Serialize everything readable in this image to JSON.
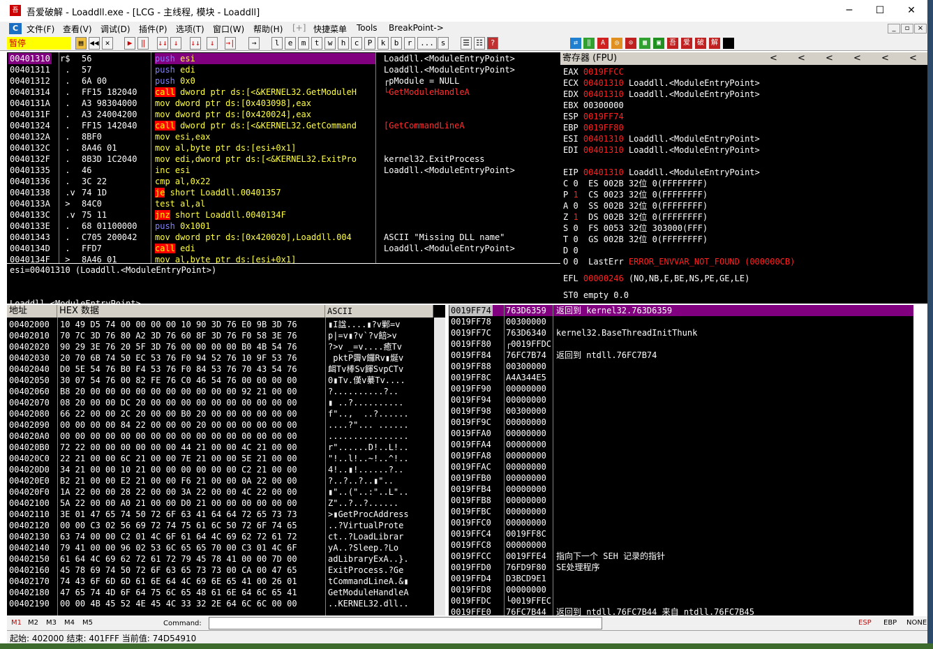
{
  "app": {
    "icon_text": "吾爱",
    "title": "吾爱破解 - Loaddll.exe - [LCG - 主线程, 模块 - Loaddll]"
  },
  "window_controls": {
    "minimize": "─",
    "maximize": "☐",
    "close": "✕"
  },
  "menu": {
    "icon_text": "C",
    "items": [
      "文件(F)",
      "查看(V)",
      "调试(D)",
      "插件(P)",
      "选项(T)",
      "窗口(W)",
      "帮助(H)",
      "[+]",
      "快捷菜单",
      "Tools",
      "BreakPoint->"
    ],
    "mdi": [
      "_",
      "▫",
      "×"
    ]
  },
  "toolbar": {
    "status": "暂停",
    "buttons": [
      "▶",
      "◀◀",
      "✕",
      "▶",
      "‖",
      "↓↓",
      "↓",
      "↓↓",
      "↓",
      "→|",
      "→",
      "l",
      "e",
      "m",
      "t",
      "w",
      "h",
      "c",
      "P",
      "k",
      "b",
      "r",
      "...",
      "s",
      "☰",
      "☷",
      "?"
    ],
    "colored": [
      "⇄",
      "‖",
      "A",
      "◎",
      "⊙",
      "▦",
      "▣",
      "吾",
      "爱",
      "破",
      "解"
    ]
  },
  "cpu": {
    "rows": [
      {
        "addr": "00401310",
        "m": "r$",
        "hex": "56",
        "asm": "push esi",
        "cmt": "Loaddll.<ModuleEntryPoint>"
      },
      {
        "addr": "00401311",
        "m": " .",
        "hex": "57",
        "asm": "push edi",
        "cmt": "Loaddll.<ModuleEntryPoint>"
      },
      {
        "addr": "00401312",
        "m": " .",
        "hex": "6A 00",
        "asm": "push 0x0",
        "cmt": "┌pModule = NULL"
      },
      {
        "addr": "00401314",
        "m": " .",
        "hex": "FF15 182040",
        "asm": "call dword ptr ds:[<&KERNEL32.GetModuleH",
        "cmt": "└GetModuleHandleA"
      },
      {
        "addr": "0040131A",
        "m": " .",
        "hex": "A3 98304000",
        "asm": "mov dword ptr ds:[0x403098],eax",
        "cmt": ""
      },
      {
        "addr": "0040131F",
        "m": " .",
        "hex": "A3 24004200",
        "asm": "mov dword ptr ds:[0x420024],eax",
        "cmt": ""
      },
      {
        "addr": "00401324",
        "m": " .",
        "hex": "FF15 142040",
        "asm": "call dword ptr ds:[<&KERNEL32.GetCommand",
        "cmt": "[GetCommandLineA"
      },
      {
        "addr": "0040132A",
        "m": " .",
        "hex": "8BF0",
        "asm": "mov esi,eax",
        "cmt": ""
      },
      {
        "addr": "0040132C",
        "m": " .",
        "hex": "8A46 01",
        "asm": "mov al,byte ptr ds:[esi+0x1]",
        "cmt": ""
      },
      {
        "addr": "0040132F",
        "m": " .",
        "hex": "8B3D 1C2040",
        "asm": "mov edi,dword ptr ds:[<&KERNEL32.ExitPro",
        "cmt": "kernel32.ExitProcess"
      },
      {
        "addr": "00401335",
        "m": " .",
        "hex": "46",
        "asm": "inc esi",
        "cmt": "Loaddll.<ModuleEntryPoint>"
      },
      {
        "addr": "00401336",
        "m": " .",
        "hex": "3C 22",
        "asm": "cmp al,0x22",
        "cmt": ""
      },
      {
        "addr": "00401338",
        "m": " .v",
        "hex": "74 1D",
        "asm": "je short Loaddll.00401357",
        "cmt": ""
      },
      {
        "addr": "0040133A",
        "m": " >",
        "hex": "84C0",
        "asm": "test al,al",
        "cmt": ""
      },
      {
        "addr": "0040133C",
        "m": " .v",
        "hex": "75 11",
        "asm": "jnz short Loaddll.0040134F",
        "cmt": ""
      },
      {
        "addr": "0040133E",
        "m": " .",
        "hex": "68 01100000",
        "asm": "push 0x1001",
        "cmt": ""
      },
      {
        "addr": "00401343",
        "m": " .",
        "hex": "C705 200042",
        "asm": "mov dword ptr ds:[0x420020],Loaddll.004",
        "cmt": "ASCII \"Missing DLL name\""
      },
      {
        "addr": "0040134D",
        "m": " .",
        "hex": "FFD7",
        "asm": "call edi",
        "cmt": "Loaddll.<ModuleEntryPoint>"
      },
      {
        "addr": "0040134F",
        "m": " >",
        "hex": "8A46 01",
        "asm": "mov al,byte ptr ds:[esi+0x1]",
        "cmt": ""
      }
    ],
    "info_line1": "esi=00401310 (Loaddll.<ModuleEntryPoint>)",
    "info_line2": "Loaddll.<ModuleEntryPoint>"
  },
  "registers": {
    "title": "寄存器 (FPU)",
    "arrows": [
      "<",
      "<",
      "<",
      "<",
      "<",
      "<"
    ],
    "lines": [
      {
        "name": "EAX",
        "val": "0019FFCC",
        "red": true,
        "desc": ""
      },
      {
        "name": "ECX",
        "val": "00401310",
        "red": true,
        "desc": "Loaddll.<ModuleEntryPoint>"
      },
      {
        "name": "EDX",
        "val": "00401310",
        "red": true,
        "desc": "Loaddll.<ModuleEntryPoint>"
      },
      {
        "name": "EBX",
        "val": "00300000",
        "red": false,
        "desc": ""
      },
      {
        "name": "ESP",
        "val": "0019FF74",
        "red": true,
        "desc": ""
      },
      {
        "name": "EBP",
        "val": "0019FF80",
        "red": true,
        "desc": ""
      },
      {
        "name": "ESI",
        "val": "00401310",
        "red": true,
        "desc": "Loaddll.<ModuleEntryPoint>"
      },
      {
        "name": "EDI",
        "val": "00401310",
        "red": true,
        "desc": "Loaddll.<ModuleEntryPoint>"
      }
    ],
    "eip": {
      "name": "EIP",
      "val": "00401310",
      "desc": "Loaddll.<ModuleEntryPoint>"
    },
    "flags": [
      {
        "f": "C",
        "v": "0",
        "red": false,
        "seg": "ES 002B 32位 0(FFFFFFFF)"
      },
      {
        "f": "P",
        "v": "1",
        "red": true,
        "seg": "CS 0023 32位 0(FFFFFFFF)"
      },
      {
        "f": "A",
        "v": "0",
        "red": false,
        "seg": "SS 002B 32位 0(FFFFFFFF)"
      },
      {
        "f": "Z",
        "v": "1",
        "red": true,
        "seg": "DS 002B 32位 0(FFFFFFFF)"
      },
      {
        "f": "S",
        "v": "0",
        "red": false,
        "seg": "FS 0053 32位 303000(FFF)"
      },
      {
        "f": "T",
        "v": "0",
        "red": false,
        "seg": "GS 002B 32位 0(FFFFFFFF)"
      },
      {
        "f": "D",
        "v": "0",
        "red": false,
        "seg": ""
      }
    ],
    "lasterr_label": "O 0  LastErr",
    "lasterr_val": "ERROR_ENVVAR_NOT_FOUND (000000CB)",
    "efl_label": "EFL",
    "efl_val": "00000246",
    "efl_desc": "(NO,NB,E,BE,NS,PE,GE,LE)",
    "st0": "ST0 empty 0.0"
  },
  "dump": {
    "h_addr": "地址",
    "h_hex": "HEX 数据",
    "h_ascii": "ASCII",
    "rows": [
      [
        "00402000",
        "10 49 D5 74 00 00 00 00 10 90 3D 76 E0 9B 3D 76",
        "▮I諡....▮?v鄛=v"
      ],
      [
        "00402010",
        "70 7C 3D 76 80 A2 3D 76 60 8F 3D 76 F0 58 3E 76",
        "p|=v▮?v`?v餢>v"
      ],
      [
        "00402020",
        "90 29 3E 76 20 5F 3D 76 00 00 00 00 B0 4B 54 76",
        "?>v _=v....癒Tv"
      ],
      [
        "00402030",
        "20 70 6B 74 50 EC 53 76 F0 94 52 76 10 9F 53 76",
        " pktP霽v饠Rv▮烻v"
      ],
      [
        "00402040",
        "D0 5E 54 76 B0 F4 53 76 F0 84 53 76 70 43 54 76",
        "衈Tv棒Sv餫SvpCTv"
      ],
      [
        "00402050",
        "30 07 54 76 00 82 FE 76 C0 46 54 76 00 00 00 00",
        "0▮Tv.傼v繤Tv...."
      ],
      [
        "00402060",
        "B8 20 00 00 00 00 00 00 00 00 00 00 92 21 00 00",
        "?..........?.."
      ],
      [
        "00402070",
        "08 20 00 00 DC 20 00 00 00 00 00 00 00 00 00 00",
        "▮ ..?.........."
      ],
      [
        "00402080",
        "66 22 00 00 2C 20 00 00 B0 20 00 00 00 00 00 00",
        "f\"..,  ..?......"
      ],
      [
        "00402090",
        "00 00 00 00 84 22 00 00 00 20 00 00 00 00 00 00",
        "....?\"... ......"
      ],
      [
        "004020A0",
        "00 00 00 00 00 00 00 00 00 00 00 00 00 00 00 00",
        "................"
      ],
      [
        "004020B0",
        "72 22 00 00 00 00 00 00 44 21 00 00 4C 21 00 00",
        "r\"......D!..L!.."
      ],
      [
        "004020C0",
        "22 21 00 00 6C 21 00 00 7E 21 00 00 5E 21 00 00",
        "\"!..l!..~!..^!.."
      ],
      [
        "004020D0",
        "34 21 00 00 10 21 00 00 00 00 00 00 C2 21 00 00",
        "4!..▮!......?.."
      ],
      [
        "004020E0",
        "B2 21 00 00 E2 21 00 00 F6 21 00 00 0A 22 00 00",
        "?..?..?..▮\".."
      ],
      [
        "004020F0",
        "1A 22 00 00 28 22 00 00 3A 22 00 00 4C 22 00 00",
        "▮\"..(\"..:\"..L\".."
      ],
      [
        "00402100",
        "5A 22 00 00 A0 21 00 00 D0 21 00 00 00 00 00 00",
        "Z\"..?..?......"
      ],
      [
        "00402110",
        "3E 01 47 65 74 50 72 6F 63 41 64 64 72 65 73 73",
        ">▮GetProcAddress"
      ],
      [
        "00402120",
        "00 00 C3 02 56 69 72 74 75 61 6C 50 72 6F 74 65",
        "..?VirtualProte"
      ],
      [
        "00402130",
        "63 74 00 00 C2 01 4C 6F 61 64 4C 69 62 72 61 72",
        "ct..?LoadLibrar"
      ],
      [
        "00402140",
        "79 41 00 00 96 02 53 6C 65 65 70 00 C3 01 4C 6F",
        "yA..?Sleep.?Lo"
      ],
      [
        "00402150",
        "61 64 4C 69 62 72 61 72 79 45 78 41 00 00 7D 00",
        "adLibraryExA..}."
      ],
      [
        "00402160",
        "45 78 69 74 50 72 6F 63 65 73 73 00 CA 00 47 65",
        "ExitProcess.?Ge"
      ],
      [
        "00402170",
        "74 43 6F 6D 6D 61 6E 64 4C 69 6E 65 41 00 26 01",
        "tCommandLineA.&▮"
      ],
      [
        "00402180",
        "47 65 74 4D 6F 64 75 6C 65 48 61 6E 64 6C 65 41",
        "GetModuleHandleA"
      ],
      [
        "00402190",
        "00 00 4B 45 52 4E 45 4C 33 32 2E 64 6C 6C 00 00",
        "..KERNEL32.dll.."
      ]
    ]
  },
  "stack": {
    "rows": [
      [
        "0019FF74",
        "763D6359",
        "返回到 kernel32.763D6359"
      ],
      [
        "0019FF78",
        "00300000",
        ""
      ],
      [
        "0019FF7C",
        "763D6340",
        "kernel32.BaseThreadInitThunk"
      ],
      [
        "0019FF80",
        "┌0019FFDC",
        ""
      ],
      [
        "0019FF84",
        "76FC7B74",
        "返回到 ntdll.76FC7B74"
      ],
      [
        "0019FF88",
        "00300000",
        ""
      ],
      [
        "0019FF8C",
        "A4A344E5",
        ""
      ],
      [
        "0019FF90",
        "00000000",
        ""
      ],
      [
        "0019FF94",
        "00000000",
        ""
      ],
      [
        "0019FF98",
        "00300000",
        ""
      ],
      [
        "0019FF9C",
        "00000000",
        ""
      ],
      [
        "0019FFA0",
        "00000000",
        ""
      ],
      [
        "0019FFA4",
        "00000000",
        ""
      ],
      [
        "0019FFA8",
        "00000000",
        ""
      ],
      [
        "0019FFAC",
        "00000000",
        ""
      ],
      [
        "0019FFB0",
        "00000000",
        ""
      ],
      [
        "0019FFB4",
        "00000000",
        ""
      ],
      [
        "0019FFB8",
        "00000000",
        ""
      ],
      [
        "0019FFBC",
        "00000000",
        ""
      ],
      [
        "0019FFC0",
        "00000000",
        ""
      ],
      [
        "0019FFC4",
        "0019FF8C",
        ""
      ],
      [
        "0019FFC8",
        "00000000",
        ""
      ],
      [
        "0019FFCC",
        "0019FFE4",
        "指向下一个 SEH 记录的指针"
      ],
      [
        "0019FFD0",
        "76FD9F80",
        "SE处理程序"
      ],
      [
        "0019FFD4",
        "D3BCD9E1",
        ""
      ],
      [
        "0019FFD8",
        "00000000",
        ""
      ],
      [
        "0019FFDC",
        "└0019FFEC",
        ""
      ],
      [
        "0019FFE0",
        "76FC7B44",
        "返回到 ntdll.76FC7B44 来自 ntdll.76FC7B45"
      ]
    ]
  },
  "cmdbar": {
    "tabs": [
      "M1",
      "M2",
      "M3",
      "M4",
      "M5"
    ],
    "label": "Command:",
    "value": "",
    "regs": [
      "ESP",
      "EBP",
      "NONE"
    ]
  },
  "status": {
    "text": "起始: 402000 结束: 401FFF 当前值: 74D54910"
  },
  "colors": {
    "accent": "#800080",
    "red": "#ff2020",
    "yellow": "#ffff40"
  }
}
